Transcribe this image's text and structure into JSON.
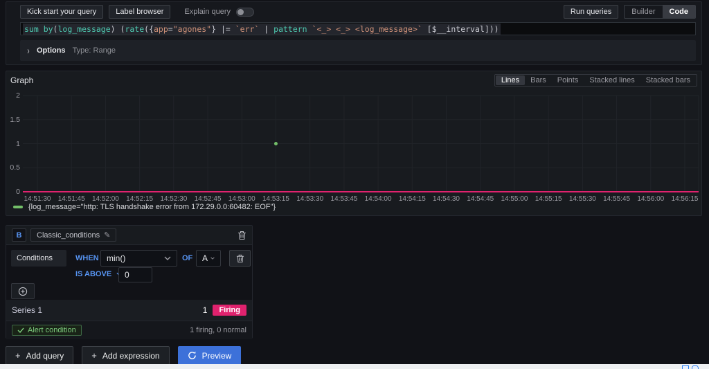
{
  "toolbar": {
    "kickstart": "Kick start your query",
    "label_browser": "Label browser",
    "explain": "Explain query",
    "run_queries": "Run queries",
    "builder": "Builder",
    "code": "Code"
  },
  "query": {
    "tokens": [
      {
        "t": "sum by",
        "c": "fn"
      },
      {
        "t": "(",
        "c": "p"
      },
      {
        "t": "log_message",
        "c": "fn"
      },
      {
        "t": ") (",
        "c": "p"
      },
      {
        "t": "rate",
        "c": "fn"
      },
      {
        "t": "({",
        "c": "p"
      },
      {
        "t": "app",
        "c": "str"
      },
      {
        "t": "=",
        "c": "p"
      },
      {
        "t": "\"agones\"",
        "c": "str"
      },
      {
        "t": "} |= ",
        "c": "p"
      },
      {
        "t": "`err`",
        "c": "str"
      },
      {
        "t": " | ",
        "c": "p"
      },
      {
        "t": "pattern",
        "c": "fn"
      },
      {
        "t": " ",
        "c": "p"
      },
      {
        "t": "`<_> <_> <log_message>`",
        "c": "str"
      },
      {
        "t": " [",
        "c": "p"
      },
      {
        "t": "$__interval",
        "c": "p"
      },
      {
        "t": "]))",
        "c": "p"
      }
    ]
  },
  "options": {
    "label": "Options",
    "type": "Type: Range"
  },
  "graph": {
    "title": "Graph",
    "modes": [
      "Lines",
      "Bars",
      "Points",
      "Stacked lines",
      "Stacked bars"
    ],
    "active_mode": "Lines"
  },
  "chart_data": {
    "type": "scatter",
    "title": "Graph",
    "x_ticks": [
      "14:51:30",
      "14:51:45",
      "14:52:00",
      "14:52:15",
      "14:52:30",
      "14:52:45",
      "14:53:00",
      "14:53:15",
      "14:53:30",
      "14:53:45",
      "14:54:00",
      "14:54:15",
      "14:54:30",
      "14:54:45",
      "14:55:00",
      "14:55:15",
      "14:55:30",
      "14:55:45",
      "14:56:00",
      "14:56:15"
    ],
    "y_ticks": [
      0,
      0.5,
      1,
      1.5,
      2
    ],
    "ylim": [
      0,
      2
    ],
    "grid": true,
    "legend_position": "bottom",
    "series": [
      {
        "name": "{log_message=\"http: TLS handshake error from 172.29.0.0:60482: EOF\"}",
        "color": "#73BF69",
        "points": [
          {
            "x": "14:53:15",
            "y": 1
          }
        ]
      }
    ],
    "threshold_line": {
      "y": 0,
      "color": "#e0226e"
    }
  },
  "expression": {
    "ref": "B",
    "name": "Classic_conditions",
    "conditions_label": "Conditions",
    "when_label": "WHEN",
    "function": "min()",
    "of_label": "OF",
    "input_ref": "A",
    "operator": "IS ABOVE",
    "threshold_value": "0",
    "series_name": "Series 1",
    "series_value": "1",
    "series_state": "Firing",
    "state_color": "#e0226e",
    "alert_badge": "Alert condition",
    "summary": "1 firing, 0 normal"
  },
  "footer": {
    "add_query": "Add query",
    "add_expression": "Add expression",
    "preview": "Preview"
  }
}
